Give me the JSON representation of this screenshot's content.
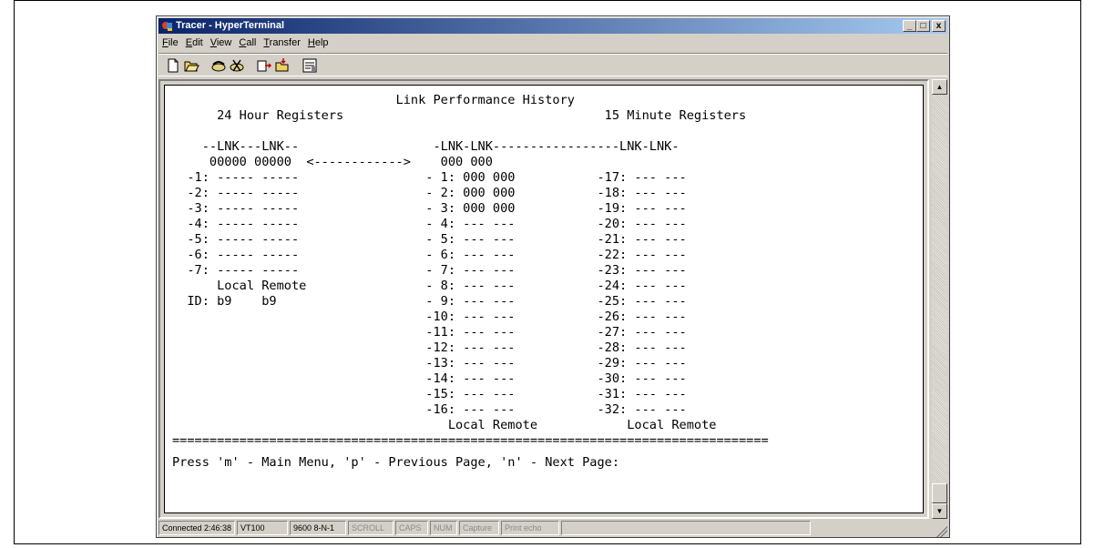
{
  "window": {
    "title": "Tracer - HyperTerminal",
    "minimize": "_",
    "maximize": "□",
    "close": "x"
  },
  "menu": {
    "items": [
      {
        "accel": "F",
        "rest": "ile"
      },
      {
        "accel": "E",
        "rest": "dit"
      },
      {
        "accel": "V",
        "rest": "iew"
      },
      {
        "accel": "C",
        "rest": "all"
      },
      {
        "accel": "T",
        "rest": "ransfer"
      },
      {
        "accel": "H",
        "rest": "elp"
      }
    ]
  },
  "toolbar": {
    "icons": [
      "new-icon",
      "open-icon",
      "connect-icon",
      "disconnect-icon",
      "send-icon",
      "receive-icon",
      "properties-icon"
    ]
  },
  "terminal": {
    "lines": [
      "                              Link Performance History",
      "      24 Hour Registers                                   15 Minute Registers",
      "",
      "    --LNK---LNK--                  -LNK-LNK-----------------LNK-LNK-",
      "     00000 00000  <------------>    000 000",
      "  -1: ----- -----                 - 1: 000 000           -17: --- ---",
      "  -2: ----- -----                 - 2: 000 000           -18: --- ---",
      "  -3: ----- -----                 - 3: 000 000           -19: --- ---",
      "  -4: ----- -----                 - 4: --- ---           -20: --- ---",
      "  -5: ----- -----                 - 5: --- ---           -21: --- ---",
      "  -6: ----- -----                 - 6: --- ---           -22: --- ---",
      "  -7: ----- -----                 - 7: --- ---           -23: --- ---",
      "      Local Remote                - 8: --- ---           -24: --- ---",
      "  ID: b9    b9                    - 9: --- ---           -25: --- ---",
      "                                  -10: --- ---           -26: --- ---",
      "                                  -11: --- ---           -27: --- ---",
      "                                  -12: --- ---           -28: --- ---",
      "                                  -13: --- ---           -29: --- ---",
      "                                  -14: --- ---           -30: --- ---",
      "                                  -15: --- ---           -31: --- ---",
      "                                  -16: --- ---           -32: --- ---",
      "                                     Local Remote            Local Remote",
      "================================================================================",
      "Press 'm' - Main Menu, 'p' - Previous Page, 'n' - Next Page:"
    ]
  },
  "status": {
    "connected": "Connected 2:46:38",
    "emulation": "VT100",
    "port": "9600 8-N-1",
    "scroll": "SCROLL",
    "caps": "CAPS",
    "num": "NUM",
    "capture": "Capture",
    "print_echo": "Print echo"
  }
}
